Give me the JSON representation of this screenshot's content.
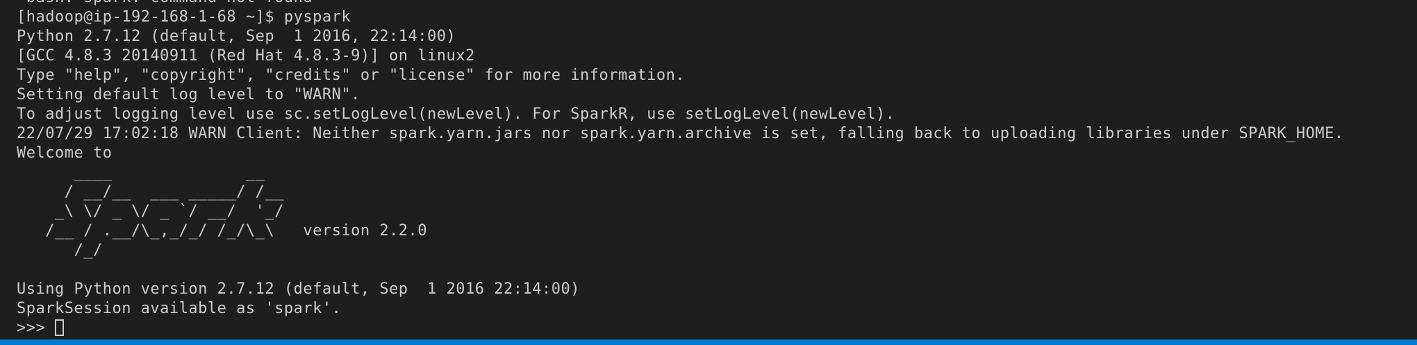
{
  "terminal": {
    "lines": [
      "-bash: spark: command not found",
      "[hadoop@ip-192-168-1-68 ~]$ pyspark",
      "Python 2.7.12 (default, Sep  1 2016, 22:14:00)",
      "[GCC 4.8.3 20140911 (Red Hat 4.8.3-9)] on linux2",
      "Type \"help\", \"copyright\", \"credits\" or \"license\" for more information.",
      "Setting default log level to \"WARN\".",
      "To adjust logging level use sc.setLogLevel(newLevel). For SparkR, use setLogLevel(newLevel).",
      "22/07/29 17:02:18 WARN Client: Neither spark.yarn.jars nor spark.yarn.archive is set, falling back to uploading libraries under SPARK_HOME.",
      "Welcome to",
      "      ____              __",
      "     / __/__  ___ _____/ /__",
      "    _\\ \\/ _ \\/ _ `/ __/  '_/",
      "   /__ / .__/\\_,_/_/ /_/\\_\\   version 2.2.0",
      "      /_/",
      "",
      "Using Python version 2.7.12 (default, Sep  1 2016 22:14:00)",
      "SparkSession available as 'spark'."
    ],
    "prompt": ">>> "
  },
  "colors": {
    "background": "#1e1e1e",
    "foreground": "#cccccc",
    "status_strip": "#007acc"
  }
}
